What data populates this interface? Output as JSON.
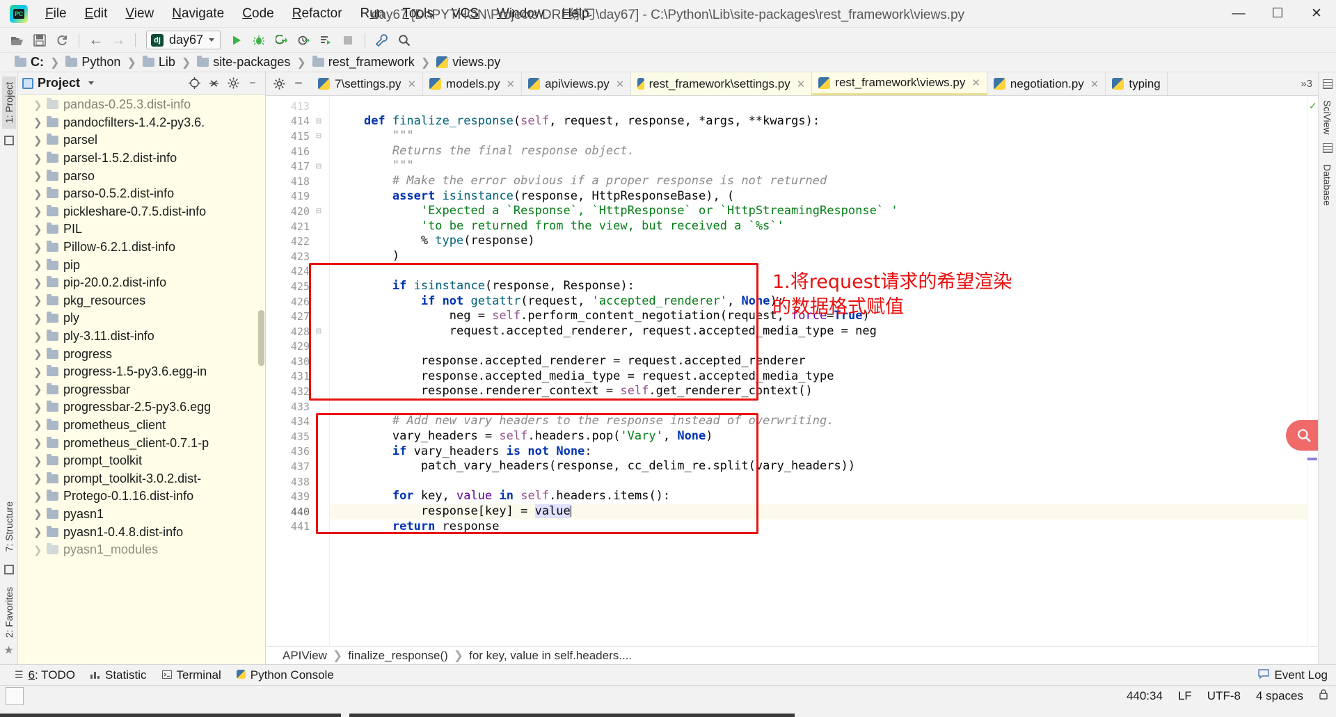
{
  "window": {
    "title": "day67 [D:\\PYTHON\\Projects\\DRF练习\\day67] - C:\\Python\\Lib\\site-packages\\rest_framework\\views.py",
    "minimize": "—",
    "maximize": "☐",
    "close": "✕"
  },
  "menu": [
    {
      "label": "File"
    },
    {
      "label": "Edit"
    },
    {
      "label": "View"
    },
    {
      "label": "Navigate"
    },
    {
      "label": "Code"
    },
    {
      "label": "Refactor"
    },
    {
      "label": "Run"
    },
    {
      "label": "Tools"
    },
    {
      "label": "VCS"
    },
    {
      "label": "Window"
    },
    {
      "label": "Help"
    }
  ],
  "toolbar": {
    "open_icon": "open-folder-icon",
    "save_icon": "save-icon",
    "sync_icon": "sync-icon",
    "back_icon": "←",
    "forward_icon": "→",
    "run_config": "day67",
    "run_config_badge": "dj",
    "run_icon": "▶",
    "debug_icon": "debug-icon",
    "coverage_icon": "coverage-icon",
    "profile_icon": "profile-icon",
    "console_icon": "console-icon",
    "stop_icon": "■",
    "settings_icon": "wrench-icon",
    "search_icon": "search-icon"
  },
  "breadcrumb": [
    {
      "label": "C:",
      "icon": "folder-icon"
    },
    {
      "label": "Python",
      "icon": "folder-icon"
    },
    {
      "label": "Lib",
      "icon": "folder-icon"
    },
    {
      "label": "site-packages",
      "icon": "folder-icon"
    },
    {
      "label": "rest_framework",
      "icon": "folder-icon"
    },
    {
      "label": "views.py",
      "icon": "python-file-icon"
    }
  ],
  "left_rail": {
    "project": "1: Project",
    "structure": "7: Structure",
    "favorites": "2: Favorites"
  },
  "right_rail": {
    "sciview": "SciView",
    "database": "Database"
  },
  "project_panel": {
    "title": "Project",
    "dropdown_icon": "chevron-down-icon",
    "locate_icon": "crosshair-icon",
    "collapse_icon": "collapse-all-icon",
    "settings_icon": "gear-icon",
    "hide_icon": "minimize-icon",
    "tree": [
      {
        "label": "pandas-0.25.3.dist-info"
      },
      {
        "label": "pandocfilters-1.4.2-py3.6."
      },
      {
        "label": "parsel"
      },
      {
        "label": "parsel-1.5.2.dist-info"
      },
      {
        "label": "parso"
      },
      {
        "label": "parso-0.5.2.dist-info"
      },
      {
        "label": "pickleshare-0.7.5.dist-info"
      },
      {
        "label": "PIL"
      },
      {
        "label": "Pillow-6.2.1.dist-info"
      },
      {
        "label": "pip"
      },
      {
        "label": "pip-20.0.2.dist-info"
      },
      {
        "label": "pkg_resources"
      },
      {
        "label": "ply"
      },
      {
        "label": "ply-3.11.dist-info"
      },
      {
        "label": "progress"
      },
      {
        "label": "progress-1.5-py3.6.egg-in"
      },
      {
        "label": "progressbar"
      },
      {
        "label": "progressbar-2.5-py3.6.egg"
      },
      {
        "label": "prometheus_client"
      },
      {
        "label": "prometheus_client-0.7.1-p"
      },
      {
        "label": "prompt_toolkit"
      },
      {
        "label": "prompt_toolkit-3.0.2.dist-"
      },
      {
        "label": "Protego-0.1.16.dist-info"
      },
      {
        "label": "pyasn1"
      },
      {
        "label": "pyasn1-0.4.8.dist-info"
      },
      {
        "label": "pyasn1_modules"
      }
    ]
  },
  "editor_tabs": [
    {
      "label": "7\\settings.py",
      "active": false,
      "icon": "python-file-icon"
    },
    {
      "label": "models.py",
      "active": false,
      "icon": "python-file-icon"
    },
    {
      "label": "api\\views.py",
      "active": false,
      "icon": "python-file-icon"
    },
    {
      "label": "rest_framework\\settings.py",
      "active": false,
      "icon": "python-file-icon"
    },
    {
      "label": "rest_framework\\views.py",
      "active": true,
      "icon": "python-file-icon"
    },
    {
      "label": "negotiation.py",
      "active": false,
      "icon": "python-file-icon"
    },
    {
      "label": "typing",
      "active": false,
      "icon": "python-file-icon"
    }
  ],
  "tab_overflow": "»3",
  "code": {
    "first_line": 413,
    "lines": [
      {
        "n": 413,
        "html": "",
        "fold": ""
      },
      {
        "n": 414,
        "html": "    <span class='kw'>def</span> <span class='fn'>finalize_response</span>(<span class='selfk'>self</span>, request, response, *args, **kwargs):",
        "fold": "⊟"
      },
      {
        "n": 415,
        "html": "        <span class='doc'>\"\"\"</span>",
        "fold": "⊟"
      },
      {
        "n": 416,
        "html": "        <span class='doc'>Returns the final response object.</span>",
        "fold": ""
      },
      {
        "n": 417,
        "html": "        <span class='doc'>\"\"\"</span>",
        "fold": "⊟"
      },
      {
        "n": 418,
        "html": "        <span class='cmt'># Make the error obvious if a proper response is not returned</span>",
        "fold": ""
      },
      {
        "n": 419,
        "html": "        <span class='kw'>assert</span> <span class='fn'>isinstance</span>(response, HttpResponseBase), (",
        "fold": ""
      },
      {
        "n": 420,
        "html": "            <span class='str'>'Expected a `Response`, `HttpResponse` or `HttpStreamingResponse` '</span>",
        "fold": "⊟"
      },
      {
        "n": 421,
        "html": "            <span class='str'>'to be returned from the view, but received a `%s`'</span>",
        "fold": ""
      },
      {
        "n": 422,
        "html": "            % <span class='fn'>type</span>(response)",
        "fold": ""
      },
      {
        "n": 423,
        "html": "        )",
        "fold": ""
      },
      {
        "n": 424,
        "html": "",
        "fold": ""
      },
      {
        "n": 425,
        "html": "        <span class='kw'>if</span> <span class='fn'>isinstance</span>(response, Response):",
        "fold": ""
      },
      {
        "n": 426,
        "html": "            <span class='kw'>if</span> <span class='kw'>not</span> <span class='fn'>getattr</span>(request, <span class='str'>'accepted_renderer'</span>, <span class='kw'>None</span>):",
        "fold": ""
      },
      {
        "n": 427,
        "html": "                neg = <span class='selfk'>self</span>.perform_content_negotiation(request, <span class='kwarg'>force</span>=<span class='kw'>True</span>)",
        "fold": ""
      },
      {
        "n": 428,
        "html": "                request.accepted_renderer, request.accepted_media_type = neg",
        "fold": "⊟"
      },
      {
        "n": 429,
        "html": "",
        "fold": ""
      },
      {
        "n": 430,
        "html": "            response.accepted_renderer = request.accepted_renderer",
        "fold": ""
      },
      {
        "n": 431,
        "html": "            response.accepted_media_type = request.accepted_media_type",
        "fold": ""
      },
      {
        "n": 432,
        "html": "            response.renderer_context = <span class='selfk'>self</span>.get_renderer_context()",
        "fold": ""
      },
      {
        "n": 433,
        "html": "",
        "fold": ""
      },
      {
        "n": 434,
        "html": "        <span class='cmt'># Add new vary headers to the response instead of overwriting.</span>",
        "fold": ""
      },
      {
        "n": 435,
        "html": "        vary_headers = <span class='selfk'>self</span>.headers.pop(<span class='str'>'Vary'</span>, <span class='kw'>None</span>)",
        "fold": ""
      },
      {
        "n": 436,
        "html": "        <span class='kw'>if</span> vary_headers <span class='kw'>is</span> <span class='kw'>not</span> <span class='kw'>None</span>:",
        "fold": ""
      },
      {
        "n": 437,
        "html": "            patch_vary_headers(response, cc_delim_re.split(vary_headers))",
        "fold": ""
      },
      {
        "n": 438,
        "html": "",
        "fold": ""
      },
      {
        "n": 439,
        "html": "        <span class='kw'>for</span> key, <span class='kwarg'>value</span> <span class='kw'>in</span> <span class='selfk'>self</span>.headers.items():",
        "fold": ""
      },
      {
        "n": 440,
        "html": "            response[key] = <span class='sel-token'>value</span><span class='caretbar'></span>",
        "fold": "",
        "current": true
      },
      {
        "n": 441,
        "html": "        <span class='kw'>return</span> response",
        "fold": ""
      }
    ]
  },
  "annotations": [
    {
      "name": "annotation-1",
      "text": "1.将request请求的希望渲染\n的数据格式赋值",
      "color": "#e81010"
    }
  ],
  "code_breadcrumb": [
    {
      "label": "APIView"
    },
    {
      "label": "finalize_response()"
    },
    {
      "label": "for key, value in self.headers...."
    }
  ],
  "tool_windows": [
    {
      "label": "6: TODO",
      "icon": "list-icon"
    },
    {
      "label": "Statistic",
      "icon": "chart-icon"
    },
    {
      "label": "Terminal",
      "icon": "terminal-icon"
    },
    {
      "label": "Python Console",
      "icon": "python-console-icon"
    }
  ],
  "event_log": {
    "label": "Event Log",
    "icon": "balloon-icon"
  },
  "status_bar": {
    "position": "440:34",
    "line_ending": "LF",
    "encoding": "UTF-8",
    "indent": "4 spaces",
    "lock_icon": "lock-icon"
  },
  "colors": {
    "accent_red": "#e81010",
    "tab_active_bg": "#fffde7",
    "keyword_blue": "#0033b3",
    "string_green": "#067d17",
    "comment_gray": "#8c8c8c"
  }
}
